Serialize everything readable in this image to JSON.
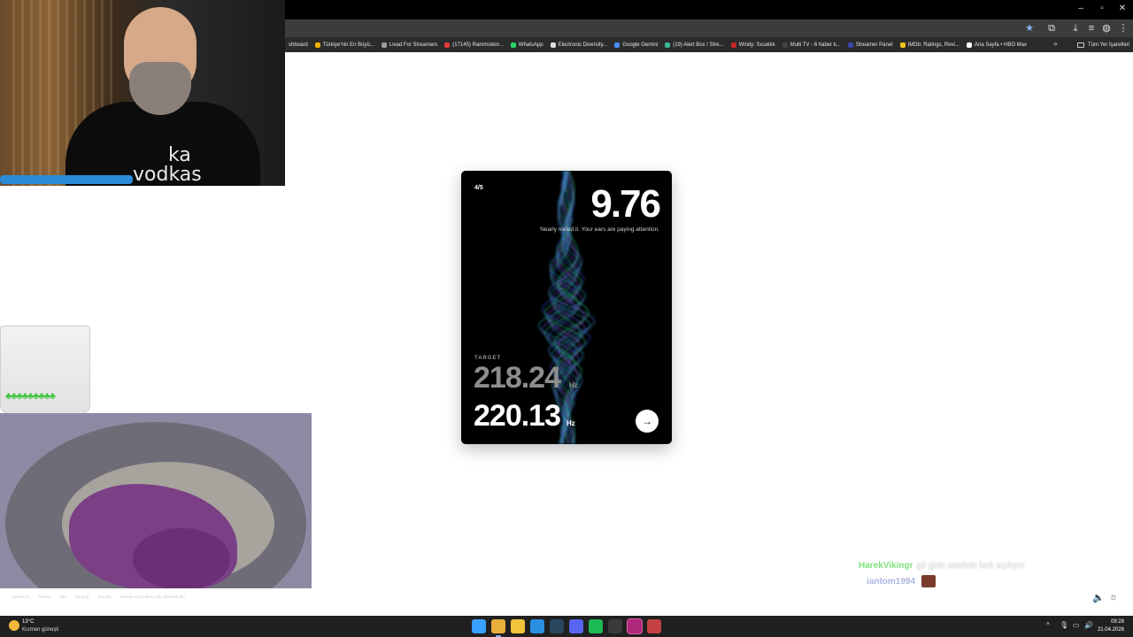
{
  "window": {
    "minimize": "–",
    "restore": "▫",
    "close": "✕"
  },
  "toolbar_icons": [
    "star-icon",
    "extensions-icon",
    "download-icon",
    "media-icon",
    "profile-icon",
    "menu-icon"
  ],
  "bookmarks": [
    {
      "label": "shboard",
      "color": "#2b2b2b"
    },
    {
      "label": "Türkiye'nin En Büyü...",
      "color": "#f4b400"
    },
    {
      "label": "Livad For Streamers",
      "color": "#9e9e9e"
    },
    {
      "label": "(17145) Rammstein...",
      "color": "#e53935"
    },
    {
      "label": "WhatsApp",
      "color": "#25d366"
    },
    {
      "label": "Electronic Diversity...",
      "color": "#dddddd"
    },
    {
      "label": "Google Gemini",
      "color": "#4a8df8"
    },
    {
      "label": "(19) Alert Box / Stre...",
      "color": "#3ab795"
    },
    {
      "label": "Windy: Sıcaklık",
      "color": "#c62828"
    },
    {
      "label": "Multi TV - 6 haber k...",
      "color": "#444444"
    },
    {
      "label": "Streamer Panel",
      "color": "#3949ab"
    },
    {
      "label": "IMDb: Ratings, Revi...",
      "color": "#f5c518"
    },
    {
      "label": "Ana Sayfa • HBO Max",
      "color": "#ffffff"
    }
  ],
  "bookmarks_overflow": "»",
  "all_bookmarks": "Tüm Yer İşaretleri",
  "webcam": {
    "shirt_text_line1": "ka",
    "shirt_text_line2": "vodkas"
  },
  "cup": {
    "clovers": "♣♣♣♣♣♣♣♣♣"
  },
  "game": {
    "round": "4/5",
    "score": "9.76",
    "feedback": "Nearly nailed it. Your ears are paying attention.",
    "target_label": "TARGET",
    "target_value": "218.24",
    "target_unit": "Hz",
    "guess_value": "220.13",
    "guess_unit": "Hz",
    "next_icon": "→"
  },
  "footer": [
    "Sound UI",
    "Privacy",
    "Info",
    "Scoring",
    "Sounds",
    "Version ref or about rdy selected info"
  ],
  "chat": [
    {
      "user": "HarekVikingr",
      "message": "git gide aradaki fark açılıyor"
    },
    {
      "user": "iantom1994",
      "message": ""
    }
  ],
  "side_controls": {
    "volume": "🔈",
    "brightness": "☼"
  },
  "taskbar": {
    "weather_temp": "13°C",
    "weather_desc": "Kısmen güneşli",
    "time": "09:28",
    "date": "21.04.2026",
    "apps": [
      {
        "name": "windows-start",
        "color": "#3aa0ff"
      },
      {
        "name": "chrome",
        "color": "#e8b03a"
      },
      {
        "name": "file-explorer",
        "color": "#f2c33c"
      },
      {
        "name": "vscode",
        "color": "#2b8fe0"
      },
      {
        "name": "steam",
        "color": "#2a475e"
      },
      {
        "name": "discord",
        "color": "#5865f2"
      },
      {
        "name": "spotify",
        "color": "#1db954"
      },
      {
        "name": "epic-games",
        "color": "#3a3a3a"
      },
      {
        "name": "next-app",
        "color": "#b0287a"
      },
      {
        "name": "obs",
        "color": "#c44242"
      }
    ],
    "tray_icons": {
      "chevron": "^",
      "mic": "🎙",
      "network": "▭",
      "volume": "🔊",
      "battery": "▮"
    }
  }
}
